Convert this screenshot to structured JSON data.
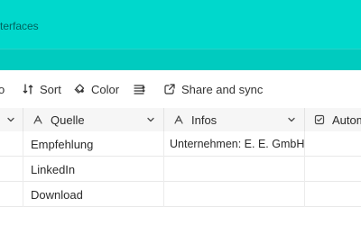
{
  "header": {
    "text": "terfaces",
    "color": "#00d8cc",
    "subbar_color": "#00cbbf"
  },
  "toolbar": {
    "partial_left_label": "o",
    "items": [
      {
        "label": "Sort",
        "icon": "sort-icon"
      },
      {
        "label": "Color",
        "icon": "paint-bucket-icon"
      },
      {
        "label": "",
        "icon": "row-height-icon"
      },
      {
        "label": "Share and sync",
        "icon": "external-link-icon"
      }
    ]
  },
  "table": {
    "columns": [
      {
        "label": "",
        "icon": "chevron-down-icon"
      },
      {
        "label": "Quelle",
        "icon": "text-field-icon"
      },
      {
        "label": "Infos",
        "icon": "text-field-icon"
      },
      {
        "label": "Automa",
        "icon": "checkbox-field-icon"
      }
    ],
    "rows": [
      {
        "quelle": "Empfehlung",
        "infos": "Unternehmen: E. E. GmbH, ..."
      },
      {
        "quelle": "LinkedIn",
        "infos": ""
      },
      {
        "quelle": "Download",
        "infos": ""
      }
    ]
  }
}
